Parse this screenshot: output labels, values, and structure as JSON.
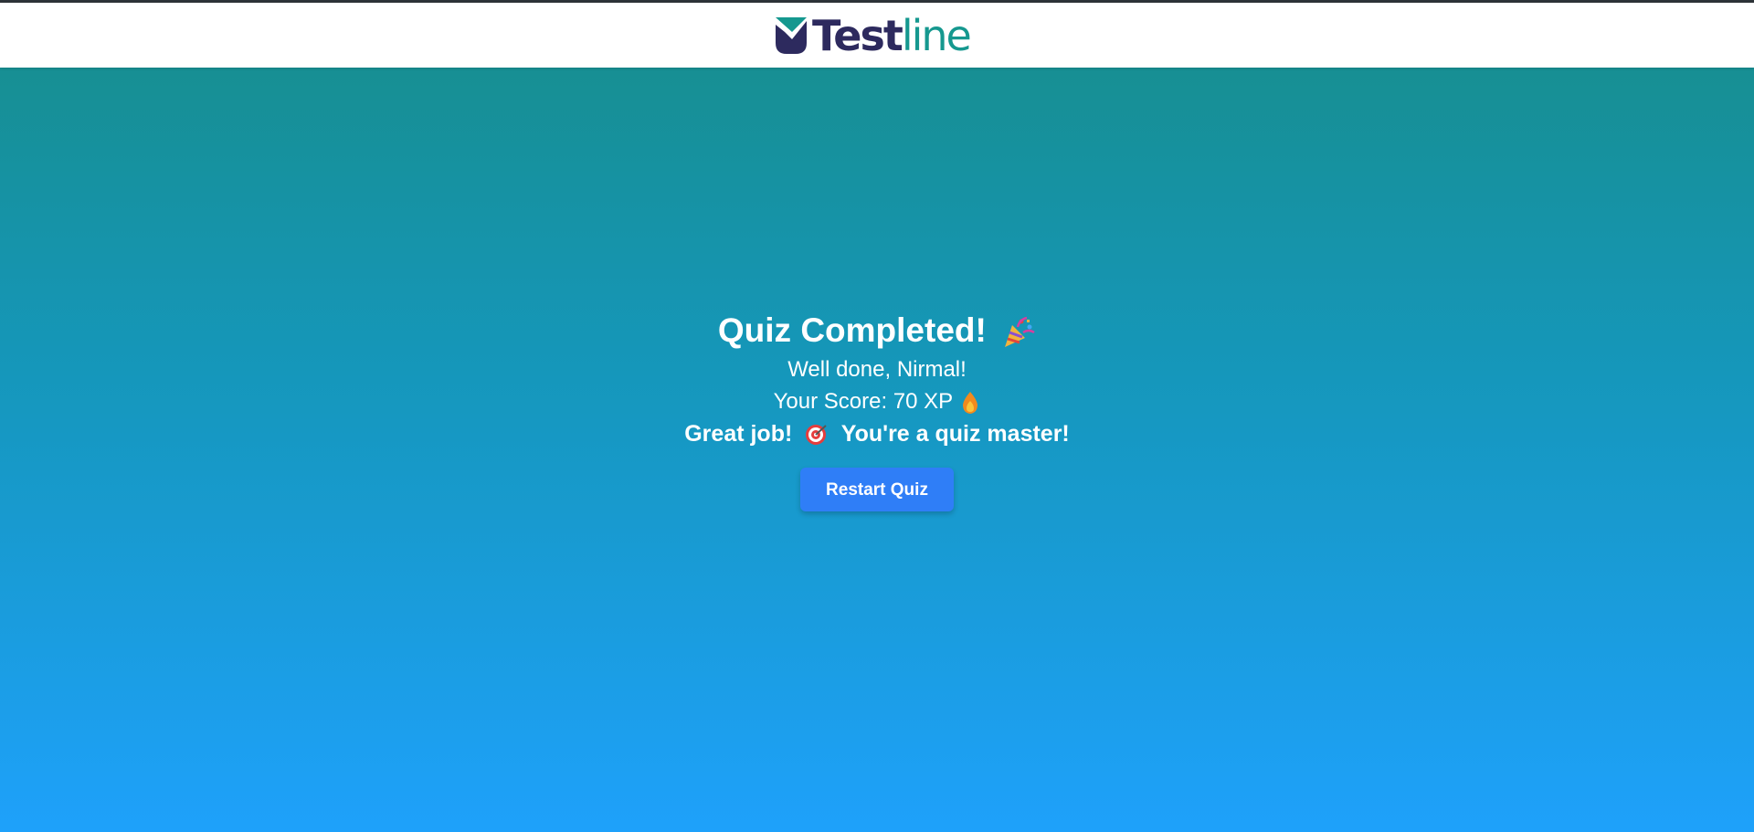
{
  "brand": {
    "name_part1": "Test",
    "name_part2": "line",
    "color_dark": "#2d2a5e",
    "color_teal": "#15988f"
  },
  "result": {
    "title": "Quiz Completed!",
    "title_icon": "party-popper-icon",
    "greeting": "Well done, Nirmal!",
    "score_label": "Your Score: 70 XP",
    "score_icon": "fire-icon",
    "message_part1": "Great job!",
    "message_icon": "target-icon",
    "message_part2": "You're a quiz master!"
  },
  "actions": {
    "restart_label": "Restart Quiz"
  },
  "colors": {
    "gradient_top": "#178f93",
    "gradient_bottom": "#1ea1fb",
    "button": "#2f7ef7"
  }
}
